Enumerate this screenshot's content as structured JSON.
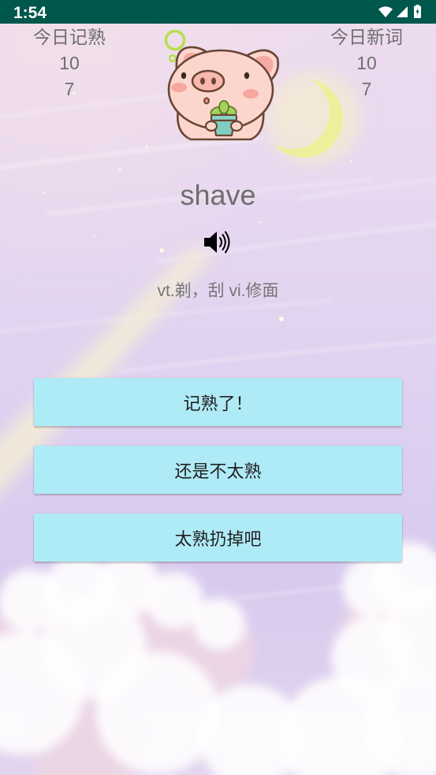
{
  "status_bar": {
    "time": "1:54",
    "icons": [
      "wifi-icon",
      "signal-icon",
      "battery-icon"
    ]
  },
  "stats": {
    "mastered_today": {
      "label": "今日记熟",
      "values": [
        "10",
        "7"
      ]
    },
    "new_words_today": {
      "label": "今日新词",
      "values": [
        "10",
        "7"
      ]
    }
  },
  "word": {
    "text": "shave",
    "pronounce_icon": "speaker-icon",
    "meaning": "vt.剃，刮 vi.修面"
  },
  "actions": [
    {
      "label": "记熟了！"
    },
    {
      "label": "还是不太熟"
    },
    {
      "label": "太熟扔掉吧"
    }
  ],
  "colors": {
    "status_bar": "#00574B",
    "button_bg": "#AFEBF6",
    "button_text": "#1F1F1F",
    "text_secondary": "#6E6E6E",
    "text_meaning": "#757575"
  }
}
